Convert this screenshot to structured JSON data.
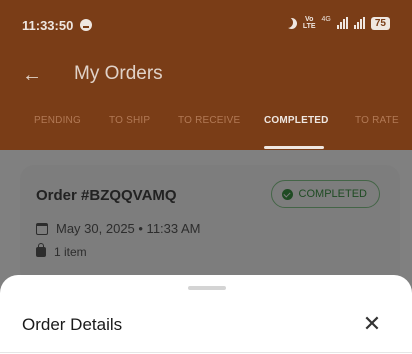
{
  "status_bar": {
    "time": "11:33:50",
    "volte_top": "Vo",
    "volte_bottom": "LTE",
    "network": "4G",
    "battery": "75"
  },
  "header": {
    "back_icon": "arrow-left-icon",
    "title": "My Orders"
  },
  "tabs": [
    {
      "label": "PENDING",
      "active": false
    },
    {
      "label": "TO SHIP",
      "active": false
    },
    {
      "label": "TO RECEIVE",
      "active": false
    },
    {
      "label": "COMPLETED",
      "active": true
    },
    {
      "label": "TO RATE",
      "active": false
    }
  ],
  "order_card": {
    "order_id": "Order #BZQQVAMQ",
    "status": "COMPLETED",
    "date": "May 30, 2025 • 11:33 AM",
    "items": "1 item"
  },
  "sheet": {
    "title": "Order Details",
    "close_icon": "close-icon"
  },
  "colors": {
    "brand": "#c0622d",
    "status_green": "#2e7d32"
  }
}
